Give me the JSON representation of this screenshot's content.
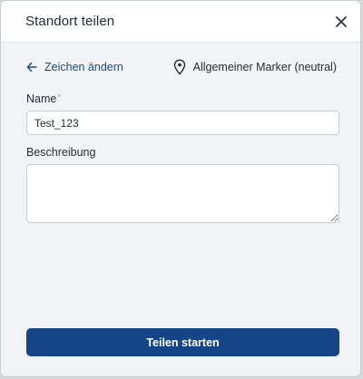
{
  "dialog": {
    "title": "Standort teilen",
    "close_icon": "close-icon"
  },
  "back_link": {
    "label": "Zeichen ändern",
    "icon": "arrow-left-icon",
    "color": "#1c4a86"
  },
  "marker": {
    "label": "Allgemeiner Marker (neutral)",
    "icon": "map-pin-icon"
  },
  "form": {
    "name_label": "Name",
    "name_required_mark": "*",
    "name_value": "Test_123",
    "description_label": "Beschreibung",
    "description_value": ""
  },
  "actions": {
    "submit_label": "Teilen starten",
    "submit_color": "#164587"
  }
}
